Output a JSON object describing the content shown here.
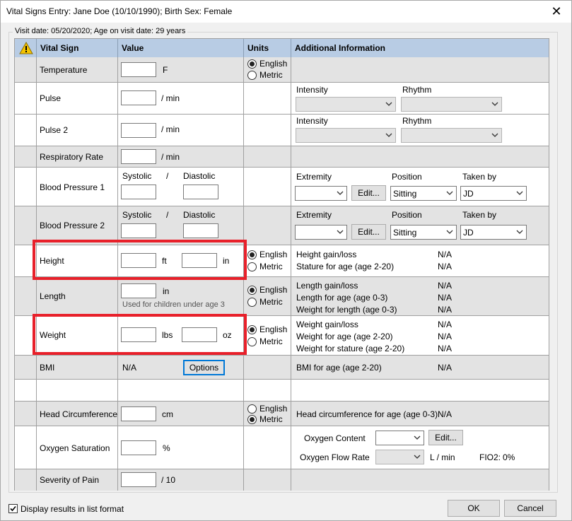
{
  "window": {
    "title": "Vital Signs Entry: Jane Doe (10/10/1990); Birth Sex: Female"
  },
  "visit": "Visit date: 05/20/2020; Age on visit date: 29 years",
  "headers": {
    "vital": "Vital Sign",
    "value": "Value",
    "units": "Units",
    "info": "Additional Information"
  },
  "units": {
    "english": "English",
    "metric": "Metric"
  },
  "rows": {
    "temperature": {
      "label": "Temperature",
      "unit": "F",
      "value": ""
    },
    "pulse": {
      "label": "Pulse",
      "unit": "/ min",
      "value": "",
      "intensity": "Intensity",
      "rhythm": "Rhythm"
    },
    "pulse2": {
      "label": "Pulse 2",
      "unit": "/ min",
      "value": "",
      "intensity": "Intensity",
      "rhythm": "Rhythm"
    },
    "resp": {
      "label": "Respiratory Rate",
      "unit": "/ min",
      "value": ""
    },
    "bp1": {
      "label": "Blood Pressure 1",
      "systolic": "Systolic",
      "slash": "/",
      "diastolic": "Diastolic",
      "extremity": "Extremity",
      "position": "Position",
      "takenby": "Taken by",
      "edit": "Edit...",
      "position_value": "Sitting",
      "takenby_value": "JD"
    },
    "bp2": {
      "label": "Blood Pressure 2",
      "systolic": "Systolic",
      "slash": "/",
      "diastolic": "Diastolic",
      "extremity": "Extremity",
      "position": "Position",
      "takenby": "Taken by",
      "edit": "Edit...",
      "position_value": "Sitting",
      "takenby_value": "JD"
    },
    "height": {
      "label": "Height",
      "unit1": "ft",
      "unit2": "in",
      "info1": "Height gain/loss",
      "info1v": "N/A",
      "info2": "Stature for age (age 2-20)",
      "info2v": "N/A"
    },
    "length": {
      "label": "Length",
      "unit": "in",
      "hint": "Used for children under age 3",
      "info1": "Length gain/loss",
      "info1v": "N/A",
      "info2": "Length for age (age 0-3)",
      "info2v": "N/A",
      "info3": "Weight for length (age 0-3)",
      "info3v": "N/A"
    },
    "weight": {
      "label": "Weight",
      "unit1": "lbs",
      "unit2": "oz",
      "info1": "Weight gain/loss",
      "info1v": "N/A",
      "info2": "Weight for age (age 2-20)",
      "info2v": "N/A",
      "info3": "Weight for stature (age 2-20)",
      "info3v": "N/A"
    },
    "bmi": {
      "label": "BMI",
      "value": "N/A",
      "options": "Options",
      "info1": "BMI for age (age 2-20)",
      "info1v": "N/A"
    },
    "head": {
      "label": "Head Circumference",
      "unit": "cm",
      "info1": "Head circumference for age (age 0-3)",
      "info1v": "N/A"
    },
    "oxygen": {
      "label": "Oxygen Saturation",
      "unit": "%",
      "content": "Oxygen Content",
      "edit": "Edit...",
      "flow": "Oxygen Flow Rate",
      "flowunit": "L / min",
      "fio2": "FIO2:",
      "fio2v": "0%"
    },
    "pain": {
      "label": "Severity of Pain",
      "unit": "/ 10"
    }
  },
  "footer": {
    "listformat": "Display results in list format",
    "ok": "OK",
    "cancel": "Cancel"
  }
}
